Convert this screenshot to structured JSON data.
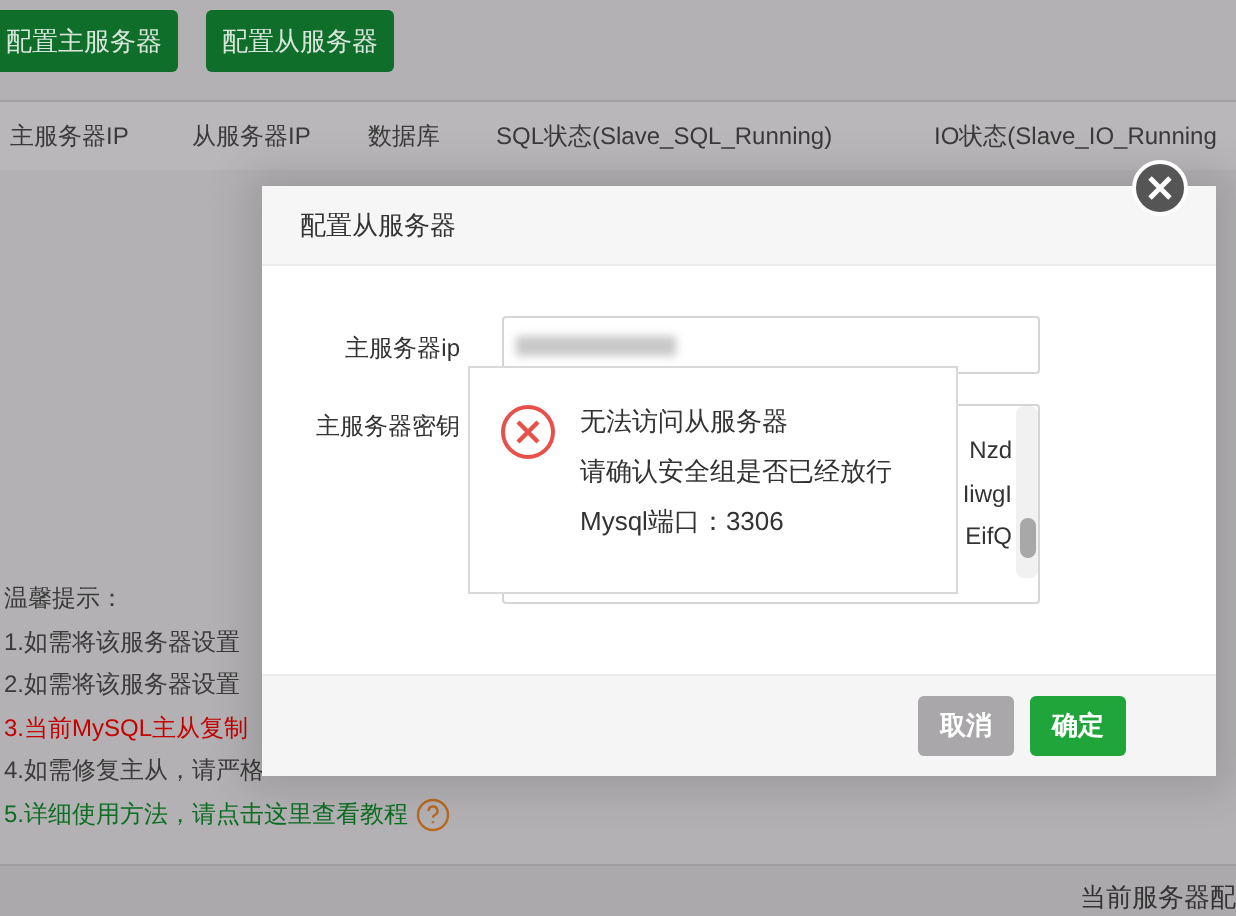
{
  "toolbar": {
    "buttons": [
      "配置主服务器",
      "配置从服务器"
    ]
  },
  "table": {
    "columns": [
      "主服务器IP",
      "从服务器IP",
      "数据库",
      "SQL状态(Slave_SQL_Running)",
      "IO状态(Slave_IO_Running"
    ]
  },
  "tips": {
    "title": "温馨提示：",
    "items": [
      {
        "kind": "normal",
        "text": "1.如需将该服务器设置"
      },
      {
        "kind": "normal",
        "text": "2.如需将该服务器设置"
      },
      {
        "kind": "warning",
        "text": "3.当前MySQL主从复制"
      },
      {
        "kind": "normal",
        "text": "4.如需修复主从，请严格"
      },
      {
        "kind": "link",
        "text": "5.详细使用方法，请点击这里查看教程"
      }
    ]
  },
  "footer": {
    "text": "当前服务器配"
  },
  "dialog": {
    "title": "配置从服务器",
    "fields": [
      {
        "kind": "input",
        "label": "主服务器ip"
      },
      {
        "kind": "textarea",
        "label": "主服务器密钥",
        "lines": [
          "Nzd",
          "IiwgI",
          "EifQ"
        ]
      }
    ],
    "buttons": [
      {
        "label": "取消",
        "disabled": true
      },
      {
        "label": "确定",
        "disabled": false
      }
    ]
  },
  "toast": {
    "kind": "error",
    "lines": [
      "无法访问从服务器",
      "请确认安全组是否已经放行",
      "Mysql端口：3306"
    ]
  }
}
